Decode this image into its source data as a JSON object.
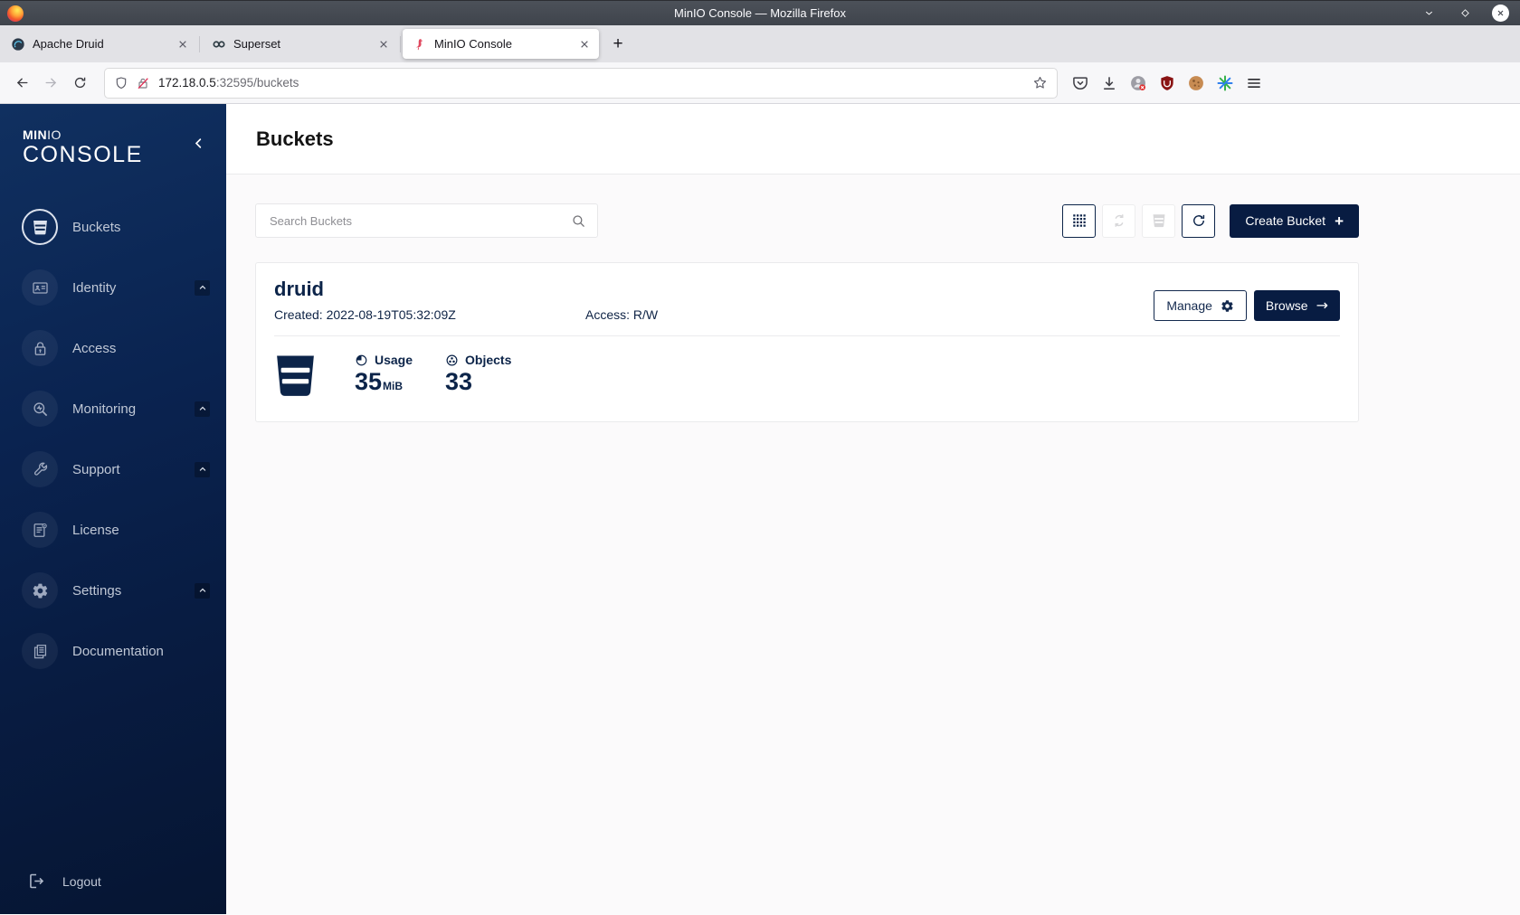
{
  "window": {
    "title": "MinIO Console — Mozilla Firefox"
  },
  "browser": {
    "tabs": [
      {
        "label": "Apache Druid"
      },
      {
        "label": "Superset"
      },
      {
        "label": "MinIO Console"
      }
    ],
    "new_tab_glyph": "+",
    "url": {
      "host": "172.18.0.5",
      "rest": ":32595/buckets"
    }
  },
  "sidebar": {
    "logo_minio_bold": "MIN",
    "logo_minio_light": "IO",
    "logo_console": "CONSOLE",
    "items": [
      {
        "label": "Buckets"
      },
      {
        "label": "Identity"
      },
      {
        "label": "Access"
      },
      {
        "label": "Monitoring"
      },
      {
        "label": "Support"
      },
      {
        "label": "License"
      },
      {
        "label": "Settings"
      },
      {
        "label": "Documentation"
      }
    ],
    "logout": "Logout"
  },
  "page": {
    "title": "Buckets",
    "search_placeholder": "Search Buckets",
    "create_button_label": "Create Bucket",
    "create_button_glyph": "+"
  },
  "bucket": {
    "name": "druid",
    "created": "Created: 2022-08-19T05:32:09Z",
    "access": "Access: R/W",
    "manage_label": "Manage",
    "browse_label": "Browse",
    "browse_glyph": "→",
    "usage": {
      "label": "Usage",
      "value": "35",
      "unit": "MiB"
    },
    "objects": {
      "label": "Objects",
      "value": "33"
    }
  },
  "colors": {
    "brand_navy": "#081C42",
    "sidebar_gradient_top": "#103060",
    "disabled_gray": "#d7d7d9"
  }
}
